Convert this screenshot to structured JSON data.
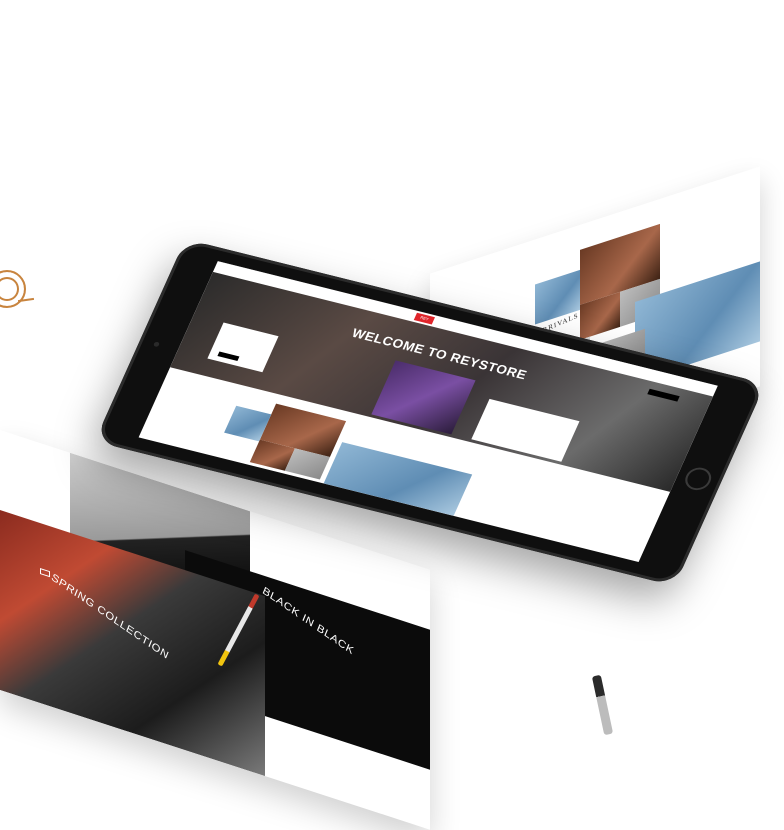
{
  "mockup": {
    "right_sheet": {
      "heading": "NEWEST ARRIVALS"
    },
    "left_sheet": {
      "black_title": "BLACK IN BLACK",
      "spring_title": "SPRING COLLECTION"
    },
    "tablet": {
      "logo": "REY",
      "welcome": "WELCOME TO REYSTORE"
    }
  },
  "colors": {
    "brand_red": "#e0252b",
    "denim": "#8fb6d4",
    "black": "#0b0b0b",
    "accent_gold": "#c8843e"
  }
}
